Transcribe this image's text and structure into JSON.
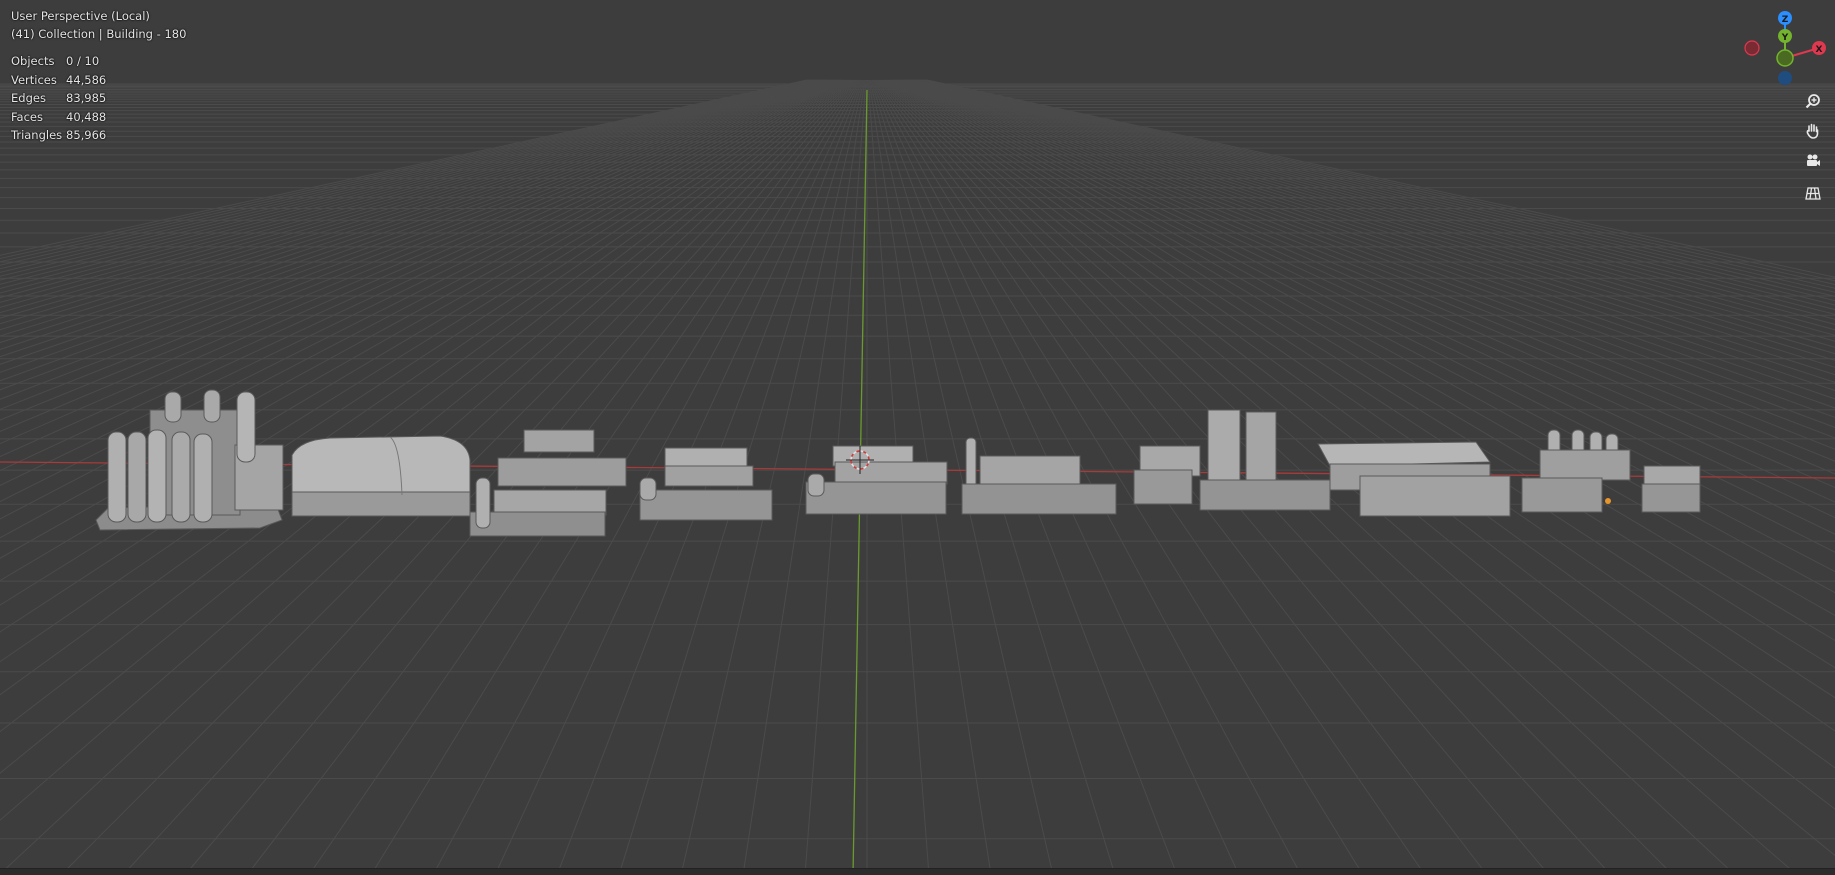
{
  "viewport": {
    "view_name": "User Perspective (Local)",
    "context_line": "(41) Collection | Building - 180"
  },
  "stats": [
    {
      "label": "Objects",
      "value": "0 / 10"
    },
    {
      "label": "Vertices",
      "value": "44,586"
    },
    {
      "label": "Edges",
      "value": "83,985"
    },
    {
      "label": "Faces",
      "value": "40,488"
    },
    {
      "label": "Triangles",
      "value": "85,966"
    }
  ],
  "gizmo": {
    "z_label": "Z",
    "y_label": "Y",
    "x_label": "X",
    "colors": {
      "x": "#e0384f",
      "y": "#73b32d",
      "z": "#2c8fff"
    }
  },
  "nav_tools": [
    {
      "name": "zoom",
      "icon": "zoom-icon"
    },
    {
      "name": "pan",
      "icon": "hand-icon"
    },
    {
      "name": "camera",
      "icon": "camera-icon"
    },
    {
      "name": "orthographic",
      "icon": "grid-icon"
    }
  ],
  "colors": {
    "background": "#3d3d3d",
    "grid": "#4d4d4d",
    "x_axis": "#b03a3a",
    "y_axis": "#6a9a2e",
    "mesh": "#9a9a9a"
  }
}
